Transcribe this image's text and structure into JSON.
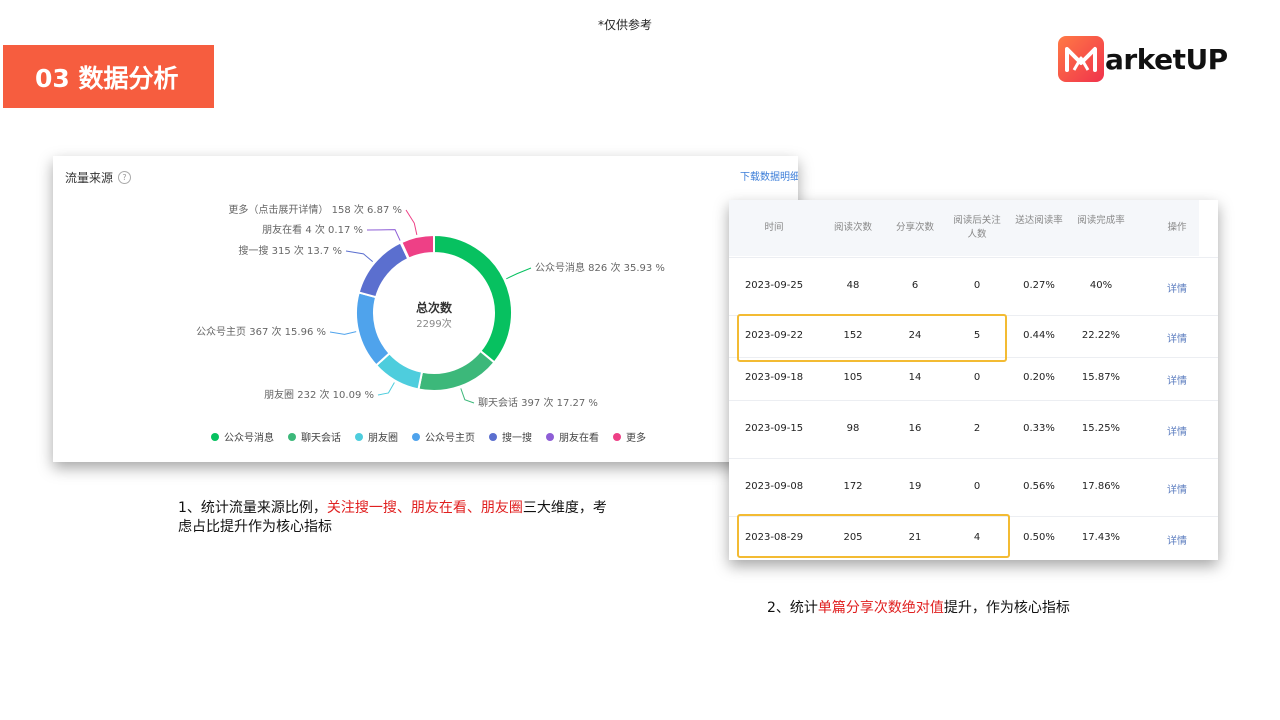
{
  "top_note": "*仅供参考",
  "section_title": "03 数据分析",
  "brand": {
    "name": "arketUP",
    "accent": "#f65d3f"
  },
  "traffic_card": {
    "title": "流量来源",
    "download_link": "下载数据明细",
    "center_label": "总次数",
    "center_value": "2299次",
    "slices": [
      {
        "name": "公众号消息",
        "label": "公众号消息 826 次 35.93 %",
        "value": 826,
        "percent": 35.93,
        "color": "#07c160"
      },
      {
        "name": "聊天会话",
        "label": "聊天会话 397 次 17.27 %",
        "value": 397,
        "percent": 17.27,
        "color": "#3cb87a"
      },
      {
        "name": "朋友圈",
        "label": "朋友圈 232 次 10.09 %",
        "value": 232,
        "percent": 10.09,
        "color": "#4ecddd"
      },
      {
        "name": "公众号主页",
        "label": "公众号主页 367 次 15.96 %",
        "value": 367,
        "percent": 15.96,
        "color": "#4fa3ec"
      },
      {
        "name": "搜一搜",
        "label": "搜一搜 315 次 13.7 %",
        "value": 315,
        "percent": 13.7,
        "color": "#5b6fcf"
      },
      {
        "name": "朋友在看",
        "label": "朋友在看 4 次 0.17 %",
        "value": 4,
        "percent": 0.17,
        "color": "#8e5ed6"
      },
      {
        "name": "更多",
        "label": "更多（点击展开详情） 158 次 6.87 %",
        "value": 158,
        "percent": 6.87,
        "color": "#ee4086"
      }
    ]
  },
  "caption1": {
    "part1": "1、统计流量来源比例，",
    "highlight": "关注搜一搜、朋友在看、朋友圈",
    "part2": "三大维度，考虑占比提升作为核心指标"
  },
  "caption2": {
    "part1": "2、统计",
    "highlight": "单篇分享次数绝对值",
    "part2": "提升，作为核心指标"
  },
  "table": {
    "headers": [
      "时间",
      "阅读次数",
      "分享次数",
      "阅读后关注人数",
      "送达阅读率",
      "阅读完成率",
      "操作"
    ],
    "rows": [
      [
        "2023-09-25",
        "48",
        "6",
        "0",
        "0.27%",
        "40%",
        "详情"
      ],
      [
        "2023-09-22",
        "152",
        "24",
        "5",
        "0.44%",
        "22.22%",
        "详情"
      ],
      [
        "2023-09-18",
        "105",
        "14",
        "0",
        "0.20%",
        "15.87%",
        "详情"
      ],
      [
        "2023-09-15",
        "98",
        "16",
        "2",
        "0.33%",
        "15.25%",
        "详情"
      ],
      [
        "2023-09-08",
        "172",
        "19",
        "0",
        "0.56%",
        "17.86%",
        "详情"
      ],
      [
        "2023-08-29",
        "205",
        "21",
        "4",
        "0.50%",
        "17.43%",
        "详情"
      ]
    ]
  }
}
